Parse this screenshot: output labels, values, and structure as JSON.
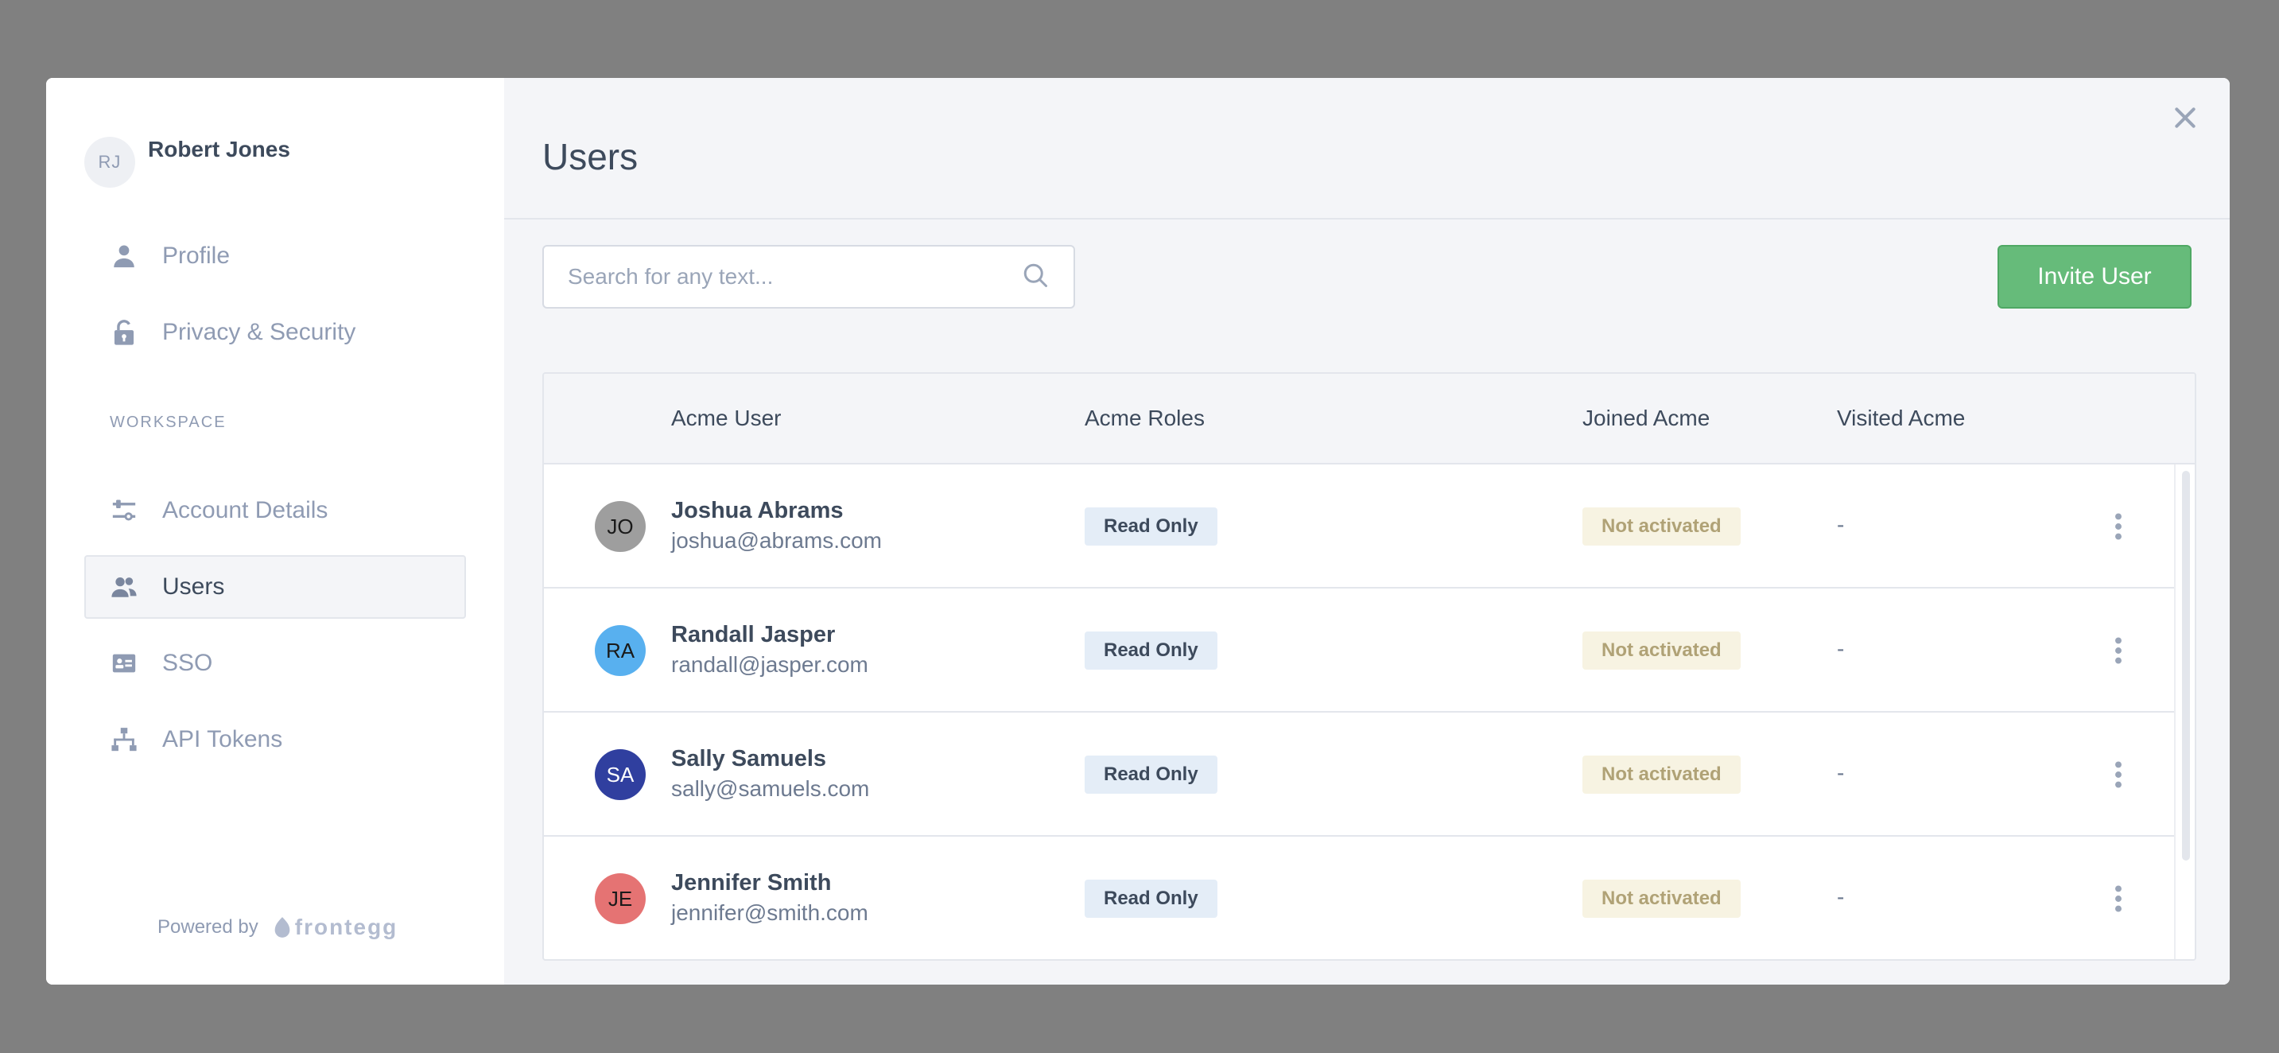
{
  "user": {
    "initials": "RJ",
    "name": "Robert Jones"
  },
  "nav": {
    "personal": [
      {
        "label": "Profile",
        "icon": "person-icon"
      },
      {
        "label": "Privacy & Security",
        "icon": "lock-icon"
      }
    ],
    "section_label": "WORKSPACE",
    "workspace": [
      {
        "label": "Account Details",
        "icon": "sliders-icon"
      },
      {
        "label": "Users",
        "icon": "users-icon",
        "active": true
      },
      {
        "label": "SSO",
        "icon": "sso-card-icon"
      },
      {
        "label": "API Tokens",
        "icon": "hierarchy-icon"
      }
    ]
  },
  "footer": {
    "powered_by": "Powered by",
    "brand": "frontegg"
  },
  "main": {
    "title": "Users",
    "search": {
      "placeholder": "Search for any text...",
      "value": ""
    },
    "invite_label": "Invite User"
  },
  "table": {
    "columns": [
      "Acme User",
      "Acme Roles",
      "Joined Acme",
      "Visited Acme"
    ],
    "rows": [
      {
        "initials": "JO",
        "avatar_color": "#9e9e9e",
        "name": "Joshua Abrams",
        "email": "joshua@abrams.com",
        "role": "Read Only",
        "joined": "Not activated",
        "visited": "-"
      },
      {
        "initials": "RA",
        "avatar_color": "#58b0ef",
        "name": "Randall Jasper",
        "email": "randall@jasper.com",
        "role": "Read Only",
        "joined": "Not activated",
        "visited": "-"
      },
      {
        "initials": "SA",
        "avatar_color": "#303f9f",
        "name": "Sally Samuels",
        "email": "sally@samuels.com",
        "role": "Read Only",
        "joined": "Not activated",
        "visited": "-"
      },
      {
        "initials": "JE",
        "avatar_color": "#e57373",
        "name": "Jennifer Smith",
        "email": "jennifer@smith.com",
        "role": "Read Only",
        "joined": "Not activated",
        "visited": "-"
      }
    ]
  },
  "colors": {
    "accent_green": "#66bb7a",
    "text_dark": "#3d4a5c",
    "text_muted": "#8f9bb3"
  }
}
